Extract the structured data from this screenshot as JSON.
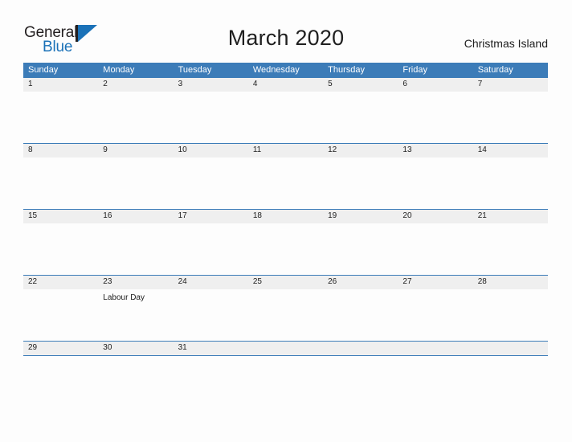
{
  "logo": {
    "word_one": "General",
    "word_two": "Blue",
    "flag_icon": "blue-triangle-flag",
    "brand_blue": "#1b72b8",
    "brand_dark": "#231f20"
  },
  "header": {
    "title": "March 2020",
    "region": "Christmas Island"
  },
  "calendar": {
    "header_color": "#3c7cb8",
    "band_color": "#efefef",
    "weekday_headers": [
      "Sunday",
      "Monday",
      "Tuesday",
      "Wednesday",
      "Thursday",
      "Friday",
      "Saturday"
    ],
    "weeks": [
      {
        "days": [
          {
            "num": "1",
            "events": []
          },
          {
            "num": "2",
            "events": []
          },
          {
            "num": "3",
            "events": []
          },
          {
            "num": "4",
            "events": []
          },
          {
            "num": "5",
            "events": []
          },
          {
            "num": "6",
            "events": []
          },
          {
            "num": "7",
            "events": []
          }
        ]
      },
      {
        "days": [
          {
            "num": "8",
            "events": []
          },
          {
            "num": "9",
            "events": []
          },
          {
            "num": "10",
            "events": []
          },
          {
            "num": "11",
            "events": []
          },
          {
            "num": "12",
            "events": []
          },
          {
            "num": "13",
            "events": []
          },
          {
            "num": "14",
            "events": []
          }
        ]
      },
      {
        "days": [
          {
            "num": "15",
            "events": []
          },
          {
            "num": "16",
            "events": []
          },
          {
            "num": "17",
            "events": []
          },
          {
            "num": "18",
            "events": []
          },
          {
            "num": "19",
            "events": []
          },
          {
            "num": "20",
            "events": []
          },
          {
            "num": "21",
            "events": []
          }
        ]
      },
      {
        "days": [
          {
            "num": "22",
            "events": []
          },
          {
            "num": "23",
            "events": [
              "Labour Day"
            ]
          },
          {
            "num": "24",
            "events": []
          },
          {
            "num": "25",
            "events": []
          },
          {
            "num": "26",
            "events": []
          },
          {
            "num": "27",
            "events": []
          },
          {
            "num": "28",
            "events": []
          }
        ]
      },
      {
        "days": [
          {
            "num": "29",
            "events": []
          },
          {
            "num": "30",
            "events": []
          },
          {
            "num": "31",
            "events": []
          },
          {
            "num": "",
            "events": []
          },
          {
            "num": "",
            "events": []
          },
          {
            "num": "",
            "events": []
          },
          {
            "num": "",
            "events": []
          }
        ]
      }
    ]
  }
}
